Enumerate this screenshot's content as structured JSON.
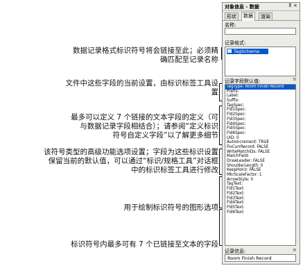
{
  "panel": {
    "title": "对象信息 - 数据",
    "pin_icon": "⊼",
    "close_icon": "×",
    "tabs": [
      "形状",
      "数据",
      "渲染"
    ],
    "active_tab": 1,
    "name_label": "名称:",
    "format_label": "记录格式:",
    "format_selected": "TagSchema",
    "defaults_label": "记录字段默认值:",
    "default_rows": [
      "TagType: Room Finish Record",
      "Prefix:",
      "Label:",
      "Suffix:",
      "TagSpec:",
      "Fld1Spec:",
      "Fld2Spec:",
      "Fld3Spec:",
      "Fld4Spec:",
      "Fld5Spec:",
      "Fld6Spec:",
      "UID: 0",
      "AutoIncrement: TRUE",
      "FixCurrRecord: FALSE",
      "WriteMatchIDs: FALSE",
      "MatchField:",
      "DrawLeader: FALSE",
      "ShoulderLength: 0",
      "KeepHoriz: FALSE",
      "MkrScaleFactor: 1",
      "ArrowStyle: 0",
      "TagText:",
      "Fld1Text:",
      "Fld2Text:",
      "Fld3Text:",
      "Fld4Text:",
      "Fld5Text:",
      "Fld6Text:"
    ],
    "record_info_label": "记录信息:",
    "record_info_value": "Room Finish Record"
  },
  "annotations": [
    "数据记录格式标识符号将会链接至此；必须精\n确匹配至记录名称",
    "文件中这些字段的当前设置，由标识标签工具设\n置",
    "最多可以定义 7 个链接的文本字段的定义（可\n与数据记录字段相结合）；请参阅“定义标识\n符号自定义字段”以了解更多细节",
    "该符号类型的高级功能选项设置；字段为这些标识设置\n保留当前的默认值，可以通过“标识/规格工具”对话框\n中的标识标签工具进行修改",
    "用于绘制标识符号的图形选项",
    "标识符号内最多可有 7 个已链接至文本的字段"
  ]
}
